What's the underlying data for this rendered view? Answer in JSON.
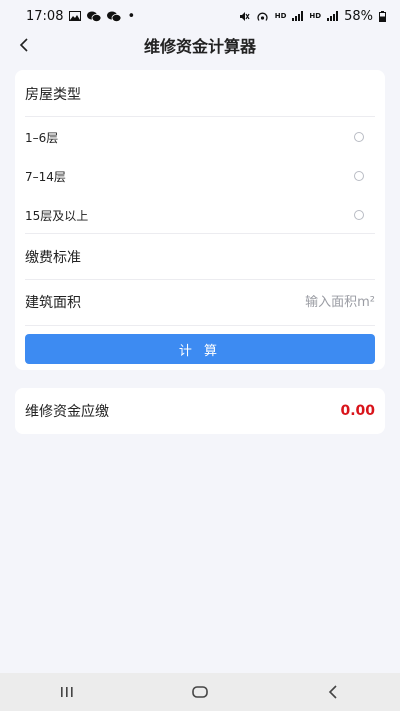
{
  "status_bar": {
    "time": "17:08",
    "battery": "58%",
    "dot": "•",
    "hd1": "HD",
    "hd2": "HD"
  },
  "header": {
    "title": "维修资金计算器"
  },
  "house_type": {
    "label": "房屋类型",
    "options": [
      {
        "label": "1–6层",
        "selected": false
      },
      {
        "label": "7–14层",
        "selected": false
      },
      {
        "label": "15层及以上",
        "selected": false
      }
    ]
  },
  "fee_standard": {
    "label": "缴费标准",
    "value": ""
  },
  "area": {
    "label": "建筑面积",
    "value": "",
    "placeholder": "输入面积m²"
  },
  "calculate_button": {
    "label": "计 算"
  },
  "result": {
    "label": "维修资金应缴",
    "value": "0.00"
  },
  "colors": {
    "accent": "#3d8bf2",
    "result_value": "#d9141b",
    "background": "#f4f5fa"
  },
  "icons": {
    "status_left": [
      "gallery-icon",
      "wechat-icon",
      "wechat-icon"
    ],
    "status_right": [
      "mute-icon",
      "hotspot-icon",
      "signal-icon",
      "signal-icon",
      "battery-icon"
    ],
    "nav": [
      "recent-apps-icon",
      "home-icon",
      "back-icon"
    ]
  }
}
